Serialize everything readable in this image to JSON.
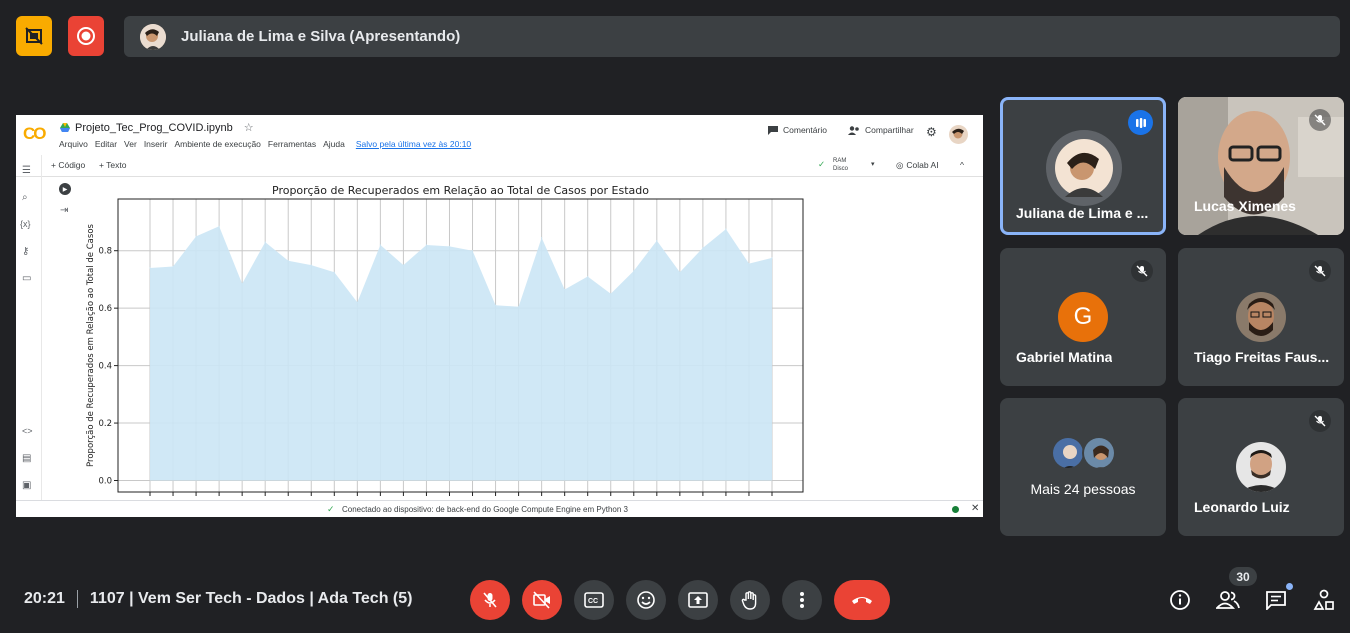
{
  "meeting": {
    "presenter_label": "Juliana de Lima e Silva (Apresentando)",
    "time": "20:21",
    "title": "1107 | Vem Ser Tech - Dados | Ada Tech (5)",
    "participant_count": "30"
  },
  "colab": {
    "logo": "CO",
    "filename": "Projeto_Tec_Prog_COVID.ipynb",
    "menu": [
      "Arquivo",
      "Editar",
      "Ver",
      "Inserir",
      "Ambiente de execução",
      "Ferramentas",
      "Ajuda"
    ],
    "saved": "Salvo pela última vez às 20:10",
    "comment": "Comentário",
    "share": "Compartilhar",
    "add_code": "+ Código",
    "add_text": "+ Texto",
    "ram": "RAM",
    "disk": "Disco",
    "colab_ai": "Colab AI",
    "status": "Conectado ao dispositivo: de back-end do Google Compute Engine em Python 3"
  },
  "chart_data": {
    "type": "area",
    "title": "Proporção de Recuperados em Relação ao Total de Casos por Estado",
    "ylabel": "Proporção de Recuperados em Relação ao Total de Casos",
    "xlabel": "",
    "ylim": [
      -0.04,
      0.98
    ],
    "yticks": [
      "0.0",
      "0.2",
      "0.4",
      "0.6",
      "0.8"
    ],
    "values": [
      0.74,
      0.745,
      0.85,
      0.885,
      0.685,
      0.83,
      0.765,
      0.75,
      0.725,
      0.62,
      0.82,
      0.75,
      0.82,
      0.815,
      0.8,
      0.61,
      0.605,
      0.845,
      0.665,
      0.71,
      0.65,
      0.73,
      0.835,
      0.725,
      0.81,
      0.875,
      0.755,
      0.775
    ],
    "fill_color": "#cbe6f5",
    "grid": true
  },
  "participants": [
    {
      "name": "Juliana de Lima e ...",
      "speaking": true
    },
    {
      "name": "Lucas Ximenes",
      "muted": true
    },
    {
      "name": "Gabriel Matina",
      "initial": "G",
      "muted": true
    },
    {
      "name": "Tiago Freitas Faus...",
      "muted": true
    },
    {
      "name": "Mais 24 pessoas"
    },
    {
      "name": "Leonardo Luiz",
      "muted": true
    }
  ],
  "colors": {
    "bg": "#202124",
    "tile": "#3c4043",
    "danger": "#ea4335",
    "accent": "#8ab4f8",
    "gabriel": "#e8710a"
  }
}
